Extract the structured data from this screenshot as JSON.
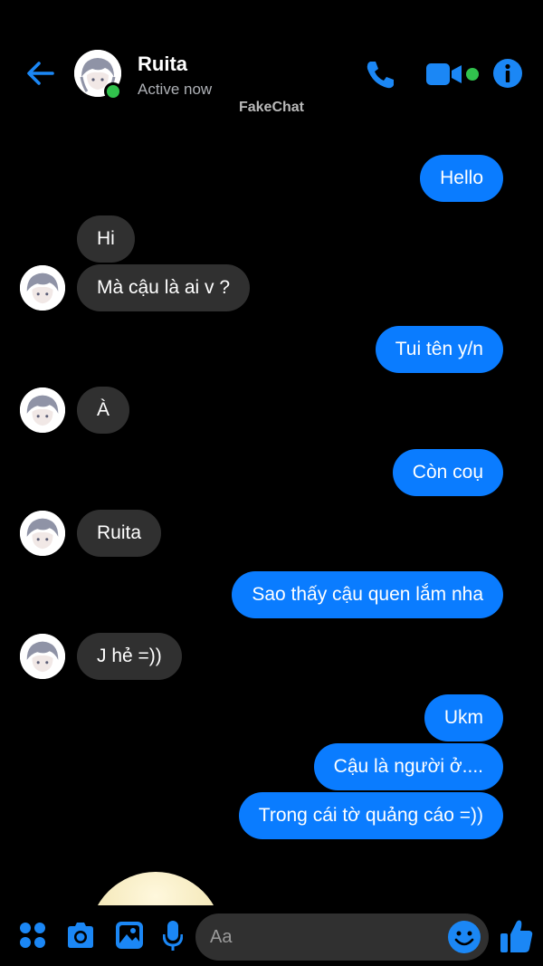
{
  "header": {
    "contact_name": "Ruita",
    "status": "Active now",
    "watermark": "FakeChat"
  },
  "icons": {
    "back": "back-arrow-icon",
    "phone": "phone-icon",
    "video": "video-camera-icon",
    "info": "info-icon",
    "apps": "apps-icon",
    "camera": "camera-icon",
    "gallery": "gallery-icon",
    "mic": "microphone-icon",
    "emoji": "emoji-icon",
    "like": "thumbs-up-icon"
  },
  "colors": {
    "accent": "#0a7cff",
    "incoming_bubble": "#303030",
    "online": "#31c24d",
    "background": "#000000"
  },
  "messages": [
    {
      "side": "out",
      "text": "Hello"
    },
    {
      "side": "in",
      "text": "Hi"
    },
    {
      "side": "in",
      "text": "Mà cậu là ai v ?"
    },
    {
      "side": "out",
      "text": "Tui tên y/n"
    },
    {
      "side": "in",
      "text": "À"
    },
    {
      "side": "out",
      "text": "Còn coụ"
    },
    {
      "side": "in",
      "text": "Ruita"
    },
    {
      "side": "out",
      "text": "Sao thấy cậu quen lắm nha"
    },
    {
      "side": "in",
      "text": "J hẻ =))"
    },
    {
      "side": "out",
      "text": "Ukm"
    },
    {
      "side": "out",
      "text": "Cậu là người ở...."
    },
    {
      "side": "out",
      "text": "Trong cái tờ quảng cáo =))"
    }
  ],
  "composer": {
    "placeholder": "Aa"
  }
}
